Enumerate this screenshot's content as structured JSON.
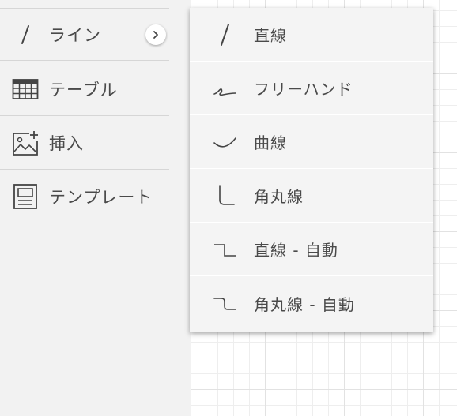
{
  "panel": {
    "items": [
      {
        "label": "ライン",
        "icon": "line-icon"
      },
      {
        "label": "テーブル",
        "icon": "table-icon"
      },
      {
        "label": "挿入",
        "icon": "insert-image-icon"
      },
      {
        "label": "テンプレート",
        "icon": "template-icon"
      }
    ]
  },
  "submenu": {
    "items": [
      {
        "label": "直線",
        "icon": "straight-line-icon"
      },
      {
        "label": "フリーハンド",
        "icon": "freehand-icon"
      },
      {
        "label": "曲線",
        "icon": "curve-icon"
      },
      {
        "label": "角丸線",
        "icon": "rounded-corner-line-icon"
      },
      {
        "label": "直線 - 自動",
        "icon": "straight-auto-icon"
      },
      {
        "label": "角丸線 - 自動",
        "icon": "rounded-auto-icon"
      }
    ]
  },
  "colors": {
    "panel_bg": "#f2f2f2",
    "submenu_bg": "#f4f4f4",
    "text": "#4a4a4a",
    "icon": "#444444"
  }
}
